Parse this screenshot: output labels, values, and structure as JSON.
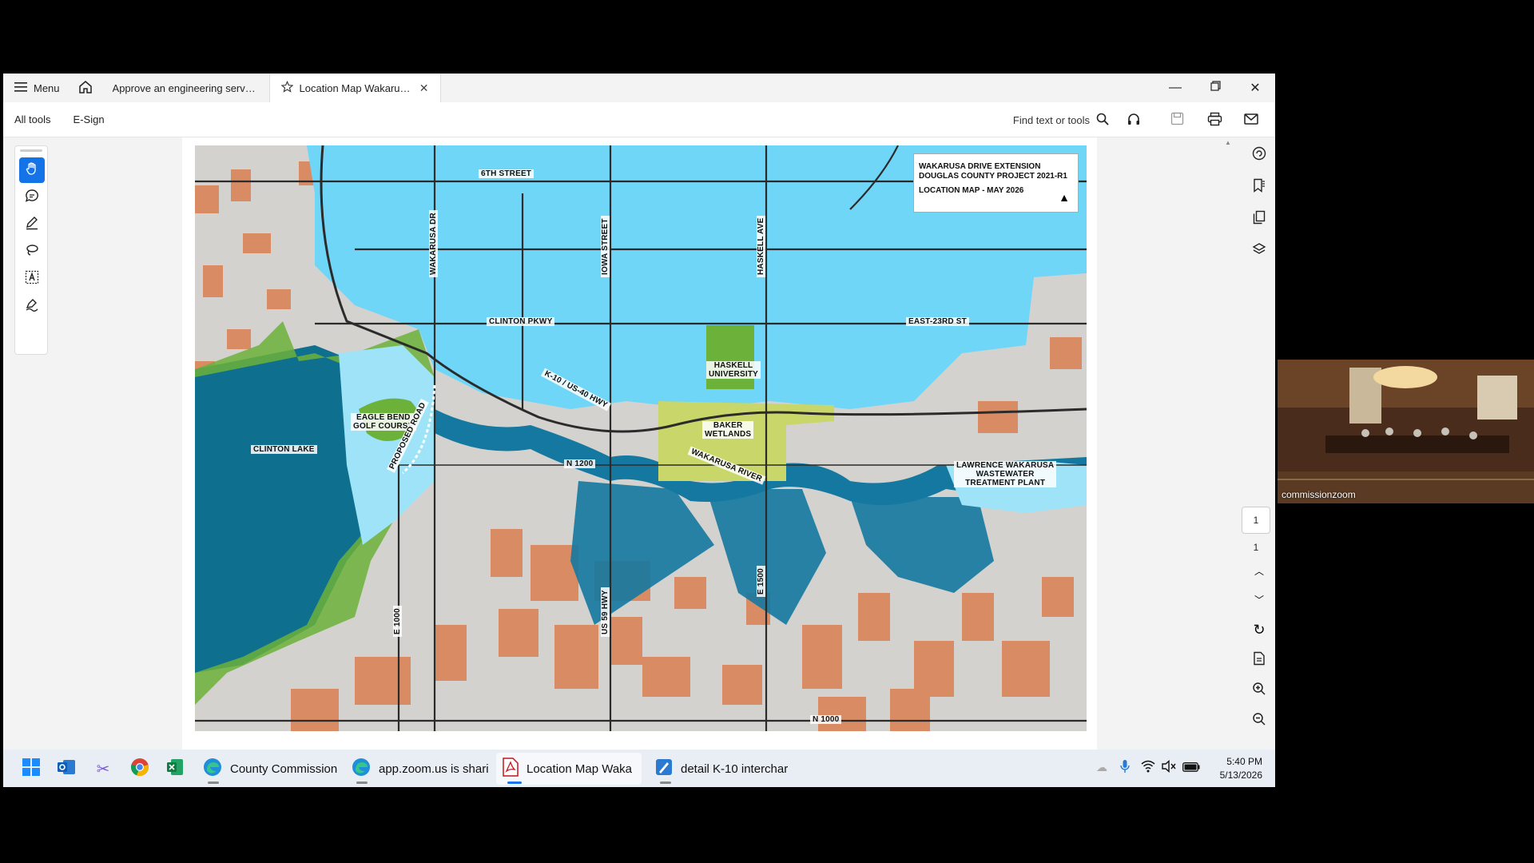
{
  "app": {
    "menu_label": "Menu",
    "tabs": [
      {
        "label": "Approve an engineering services..."
      },
      {
        "label": "Location Map Wakarusa ..."
      }
    ]
  },
  "toolbar": {
    "all_tools": "All tools",
    "esign": "E-Sign",
    "find_placeholder": "Find text or tools"
  },
  "pagination": {
    "current": "1",
    "total": "1"
  },
  "map": {
    "legend": {
      "line1": "WAKARUSA DRIVE EXTENSION",
      "line2": "DOUGLAS COUNTY PROJECT 2021-R1",
      "line3": "LOCATION MAP - MAY 2026"
    },
    "labels": {
      "sixth_street": "6TH STREET",
      "wakarusa_dr": "WAKARUSA DR",
      "iowa_street": "IOWA STREET",
      "haskell_ave": "HASKELL AVE",
      "clinton_pkwy": "CLINTON PKWY",
      "east_23rd": "EAST-23RD ST",
      "haskell_univ_1": "HASKELL",
      "haskell_univ_2": "UNIVERSITY",
      "k10": "K-10 / US-40 HWY",
      "eagle_bend_1": "EAGLE BEND",
      "eagle_bend_2": "GOLF COURSE",
      "baker_1": "BAKER",
      "baker_2": "WETLANDS",
      "clinton_lake": "CLINTON LAKE",
      "proposed_road": "PROPOSED ROAD",
      "n1200": "N 1200",
      "wakarusa_river": "WAKARUSA RIVER",
      "wwtp_1": "LAWRENCE WAKARUSA",
      "wwtp_2": "WASTEWATER",
      "wwtp_3": "TREATMENT PLANT",
      "e1000": "E 1000",
      "us59": "US 59 HWY",
      "e1500": "E 1500",
      "n1000": "N 1000"
    }
  },
  "taskbar": {
    "apps": [
      {
        "label": "County Commission"
      },
      {
        "label": "app.zoom.us is shari"
      },
      {
        "label": "Location Map Waka"
      },
      {
        "label": "detail K-10 interchar"
      }
    ],
    "time": "5:40 PM",
    "date": "5/13/2026"
  },
  "zoom": {
    "participant": "commissionzoom"
  },
  "colors": {
    "city_blue": "#6fd6f7",
    "lake_blue": "#0f6f8f",
    "river_blue": "#1478a0",
    "rural_gray": "#d4d2ce",
    "parcel_orange": "#d98b64",
    "park_green": "#6bb13a",
    "wetland_yellow": "#c8d66a",
    "accent": "#1473e6"
  }
}
